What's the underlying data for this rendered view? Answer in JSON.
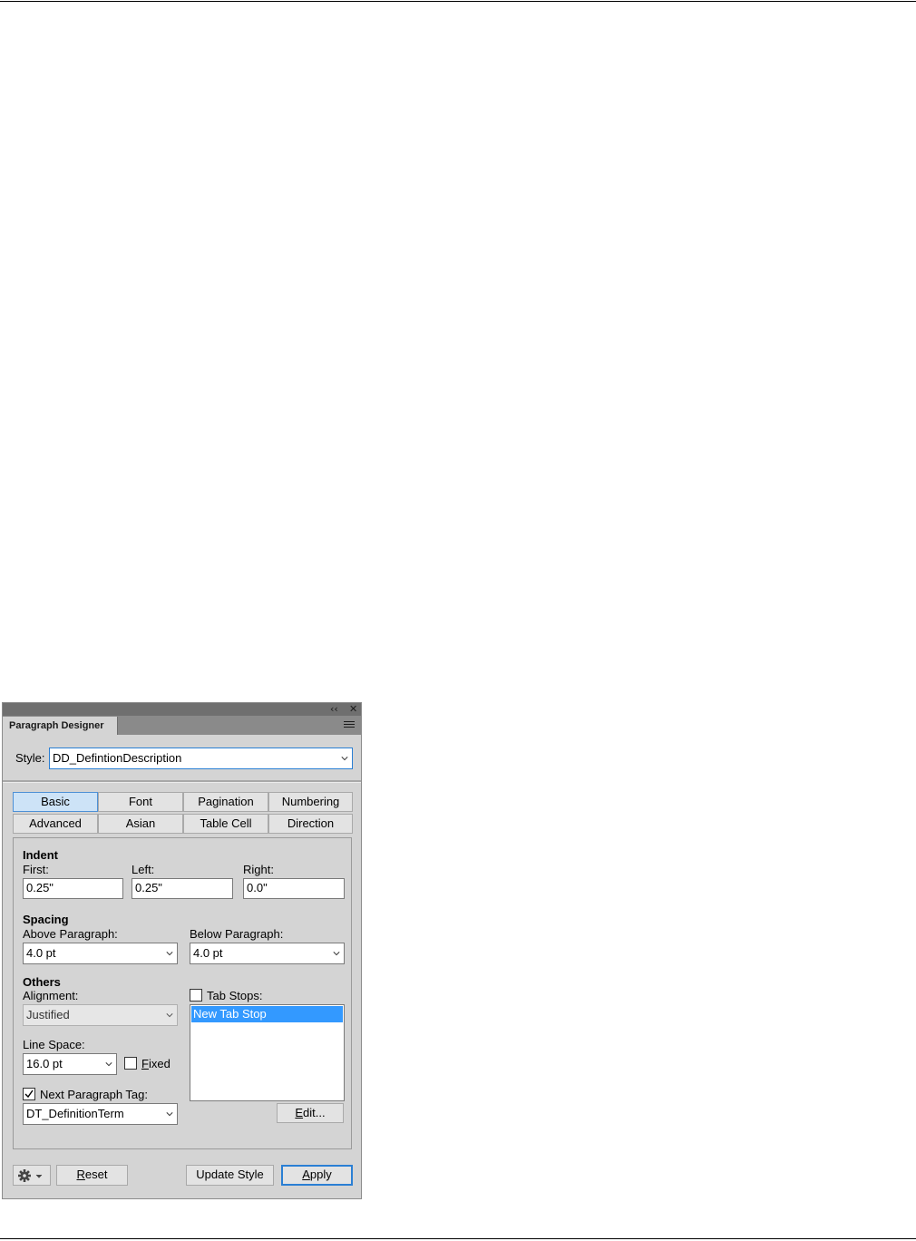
{
  "panel": {
    "collapse_glyph": "‹‹",
    "close_glyph": "✕",
    "tab_label": "Paragraph Designer",
    "menu_icon": "hamburger-menu-icon"
  },
  "style": {
    "label": "Style:",
    "value": "DD_DefintionDescription"
  },
  "tabs": {
    "row1": [
      "Basic",
      "Font",
      "Pagination",
      "Numbering"
    ],
    "row2": [
      "Advanced",
      "Asian",
      "Table Cell",
      "Direction"
    ],
    "active": "Basic"
  },
  "indent": {
    "header": "Indent",
    "first_label": "First:",
    "first_value": "0.25\"",
    "left_label": "Left:",
    "left_value": "0.25\"",
    "right_label": "Right:",
    "right_value": "0.0\""
  },
  "spacing": {
    "header": "Spacing",
    "above_label": "Above Paragraph:",
    "above_value": "4.0 pt",
    "below_label": "Below Paragraph:",
    "below_value": "4.0 pt"
  },
  "others": {
    "header": "Others",
    "alignment_label": "Alignment:",
    "alignment_value": "Justified",
    "line_space_label": "Line Space:",
    "line_space_value": "16.0 pt",
    "fixed_label_pre": "",
    "fixed_label_u": "F",
    "fixed_label_post": "ixed",
    "fixed_checked": false,
    "next_tag_label": "Next Paragraph Tag:",
    "next_tag_checked": true,
    "next_tag_value": "DT_DefinitionTerm",
    "tab_stops_label": "Tab Stops:",
    "tab_stops_checked": false,
    "tab_stops_items": [
      "New Tab Stop"
    ],
    "edit_u": "E",
    "edit_rest": "dit..."
  },
  "footer": {
    "gear_icon": "gear-icon",
    "reset_u": "R",
    "reset_rest": "eset",
    "update_label": "Update Style",
    "apply_u": "A",
    "apply_rest": "pply"
  }
}
